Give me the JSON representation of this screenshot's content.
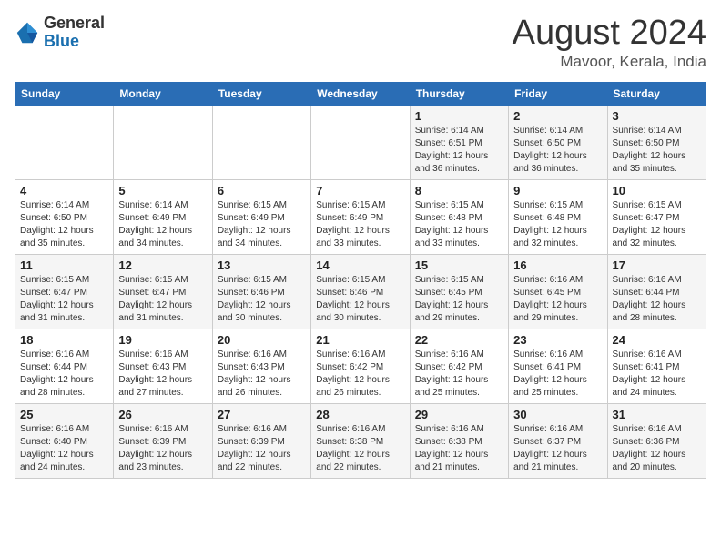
{
  "header": {
    "logo_general": "General",
    "logo_blue": "Blue",
    "month": "August 2024",
    "location": "Mavoor, Kerala, India"
  },
  "days_of_week": [
    "Sunday",
    "Monday",
    "Tuesday",
    "Wednesday",
    "Thursday",
    "Friday",
    "Saturday"
  ],
  "weeks": [
    [
      {
        "day": "",
        "info": ""
      },
      {
        "day": "",
        "info": ""
      },
      {
        "day": "",
        "info": ""
      },
      {
        "day": "",
        "info": ""
      },
      {
        "day": "1",
        "info": "Sunrise: 6:14 AM\nSunset: 6:51 PM\nDaylight: 12 hours and 36 minutes."
      },
      {
        "day": "2",
        "info": "Sunrise: 6:14 AM\nSunset: 6:50 PM\nDaylight: 12 hours and 36 minutes."
      },
      {
        "day": "3",
        "info": "Sunrise: 6:14 AM\nSunset: 6:50 PM\nDaylight: 12 hours and 35 minutes."
      }
    ],
    [
      {
        "day": "4",
        "info": "Sunrise: 6:14 AM\nSunset: 6:50 PM\nDaylight: 12 hours and 35 minutes."
      },
      {
        "day": "5",
        "info": "Sunrise: 6:14 AM\nSunset: 6:49 PM\nDaylight: 12 hours and 34 minutes."
      },
      {
        "day": "6",
        "info": "Sunrise: 6:15 AM\nSunset: 6:49 PM\nDaylight: 12 hours and 34 minutes."
      },
      {
        "day": "7",
        "info": "Sunrise: 6:15 AM\nSunset: 6:49 PM\nDaylight: 12 hours and 33 minutes."
      },
      {
        "day": "8",
        "info": "Sunrise: 6:15 AM\nSunset: 6:48 PM\nDaylight: 12 hours and 33 minutes."
      },
      {
        "day": "9",
        "info": "Sunrise: 6:15 AM\nSunset: 6:48 PM\nDaylight: 12 hours and 32 minutes."
      },
      {
        "day": "10",
        "info": "Sunrise: 6:15 AM\nSunset: 6:47 PM\nDaylight: 12 hours and 32 minutes."
      }
    ],
    [
      {
        "day": "11",
        "info": "Sunrise: 6:15 AM\nSunset: 6:47 PM\nDaylight: 12 hours and 31 minutes."
      },
      {
        "day": "12",
        "info": "Sunrise: 6:15 AM\nSunset: 6:47 PM\nDaylight: 12 hours and 31 minutes."
      },
      {
        "day": "13",
        "info": "Sunrise: 6:15 AM\nSunset: 6:46 PM\nDaylight: 12 hours and 30 minutes."
      },
      {
        "day": "14",
        "info": "Sunrise: 6:15 AM\nSunset: 6:46 PM\nDaylight: 12 hours and 30 minutes."
      },
      {
        "day": "15",
        "info": "Sunrise: 6:15 AM\nSunset: 6:45 PM\nDaylight: 12 hours and 29 minutes."
      },
      {
        "day": "16",
        "info": "Sunrise: 6:16 AM\nSunset: 6:45 PM\nDaylight: 12 hours and 29 minutes."
      },
      {
        "day": "17",
        "info": "Sunrise: 6:16 AM\nSunset: 6:44 PM\nDaylight: 12 hours and 28 minutes."
      }
    ],
    [
      {
        "day": "18",
        "info": "Sunrise: 6:16 AM\nSunset: 6:44 PM\nDaylight: 12 hours and 28 minutes."
      },
      {
        "day": "19",
        "info": "Sunrise: 6:16 AM\nSunset: 6:43 PM\nDaylight: 12 hours and 27 minutes."
      },
      {
        "day": "20",
        "info": "Sunrise: 6:16 AM\nSunset: 6:43 PM\nDaylight: 12 hours and 26 minutes."
      },
      {
        "day": "21",
        "info": "Sunrise: 6:16 AM\nSunset: 6:42 PM\nDaylight: 12 hours and 26 minutes."
      },
      {
        "day": "22",
        "info": "Sunrise: 6:16 AM\nSunset: 6:42 PM\nDaylight: 12 hours and 25 minutes."
      },
      {
        "day": "23",
        "info": "Sunrise: 6:16 AM\nSunset: 6:41 PM\nDaylight: 12 hours and 25 minutes."
      },
      {
        "day": "24",
        "info": "Sunrise: 6:16 AM\nSunset: 6:41 PM\nDaylight: 12 hours and 24 minutes."
      }
    ],
    [
      {
        "day": "25",
        "info": "Sunrise: 6:16 AM\nSunset: 6:40 PM\nDaylight: 12 hours and 24 minutes."
      },
      {
        "day": "26",
        "info": "Sunrise: 6:16 AM\nSunset: 6:39 PM\nDaylight: 12 hours and 23 minutes."
      },
      {
        "day": "27",
        "info": "Sunrise: 6:16 AM\nSunset: 6:39 PM\nDaylight: 12 hours and 22 minutes."
      },
      {
        "day": "28",
        "info": "Sunrise: 6:16 AM\nSunset: 6:38 PM\nDaylight: 12 hours and 22 minutes."
      },
      {
        "day": "29",
        "info": "Sunrise: 6:16 AM\nSunset: 6:38 PM\nDaylight: 12 hours and 21 minutes."
      },
      {
        "day": "30",
        "info": "Sunrise: 6:16 AM\nSunset: 6:37 PM\nDaylight: 12 hours and 21 minutes."
      },
      {
        "day": "31",
        "info": "Sunrise: 6:16 AM\nSunset: 6:36 PM\nDaylight: 12 hours and 20 minutes."
      }
    ]
  ]
}
